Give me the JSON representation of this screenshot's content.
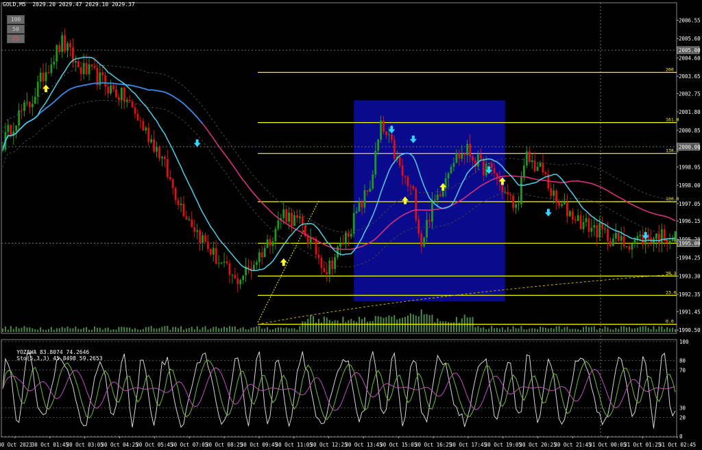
{
  "symbol_header": "GOLD,M5  2029.20 2029.47 2029.10 2029.37",
  "timeframe_buttons": [
    "100",
    "50",
    "25"
  ],
  "oscillator_header": {
    "indicator": "YOZAWA 83.8074 74.2646",
    "stochastic": "Sto(5,3,3) 45.8498 59.2653"
  },
  "colors": {
    "background": "#000000",
    "bull_candle": "#1f9a1f",
    "bear_candle": "#e01010",
    "fast_ma": "#4fd0e8",
    "slow_ma_blue": "#3a8ce8",
    "slow_ma_magenta": "#d6317a",
    "fibonacci": "#ffff00",
    "highlight_box": "#0a0a8c",
    "volume": "#4d8a4d",
    "arrow_up": "#ffff33",
    "arrow_down": "#33d6ff"
  },
  "chart_data": [
    {
      "type": "candlestick",
      "title": "GOLD,M5",
      "ylim": [
        1990.4,
        2007.1
      ],
      "price_axis_labels": [
        "2006.55",
        "2005.60",
        "2004.60",
        "2003.65",
        "2002.75",
        "2001.80",
        "2000.85",
        "1999.90",
        "1998.95",
        "1998.00",
        "1997.05",
        "1996.15",
        "1995.20",
        "1994.25",
        "1993.30",
        "1992.35",
        "1991.45",
        "1990.50"
      ],
      "price_axis_tags": [
        "2005.00",
        "2000.00",
        "1995.00"
      ],
      "time_labels": [
        "30 Oct 2023",
        "30 Oct 01:45",
        "30 Oct 03:05",
        "30 Oct 04:25",
        "30 Oct 05:45",
        "30 Oct 07:05",
        "30 Oct 08:25",
        "30 Oct 09:45",
        "30 Oct 11:05",
        "30 Oct 12:25",
        "30 Oct 13:45",
        "30 Oct 15:05",
        "30 Oct 16:25",
        "30 Oct 17:45",
        "30 Oct 19:05",
        "30 Oct 20:25",
        "30 Oct 21:45",
        "31 Oct 00:05",
        "31 Oct 01:25",
        "31 Oct 02:45"
      ],
      "price_path": [
        [
          0,
          2000.2
        ],
        [
          5,
          2001.5
        ],
        [
          10,
          2002.2
        ],
        [
          16,
          2004.0
        ],
        [
          22,
          2005.4
        ],
        [
          28,
          2004.1
        ],
        [
          34,
          2003.7
        ],
        [
          40,
          2003.0
        ],
        [
          46,
          2002.4
        ],
        [
          52,
          2001.0
        ],
        [
          58,
          1999.7
        ],
        [
          62,
          1998.2
        ],
        [
          66,
          1997.0
        ],
        [
          72,
          1995.6
        ],
        [
          78,
          1994.4
        ],
        [
          82,
          1993.7
        ],
        [
          86,
          1993.0
        ],
        [
          92,
          1993.8
        ],
        [
          98,
          1995.0
        ],
        [
          104,
          1996.6
        ],
        [
          110,
          1996.0
        ],
        [
          115,
          1994.8
        ],
        [
          120,
          1993.6
        ],
        [
          125,
          1994.8
        ],
        [
          130,
          1996.2
        ],
        [
          136,
          1998.0
        ],
        [
          140,
          2001.0
        ],
        [
          144,
          2000.0
        ],
        [
          148,
          1998.5
        ],
        [
          152,
          1997.5
        ],
        [
          155,
          1995.0
        ],
        [
          158,
          1996.5
        ],
        [
          162,
          1997.8
        ],
        [
          166,
          1999.3
        ],
        [
          172,
          1999.8
        ],
        [
          177,
          1999.0
        ],
        [
          182,
          1998.7
        ],
        [
          186,
          1997.6
        ],
        [
          190,
          1996.8
        ],
        [
          194,
          1999.4
        ],
        [
          200,
          1998.7
        ],
        [
          205,
          1997.0
        ],
        [
          210,
          1996.6
        ],
        [
          215,
          1996.0
        ],
        [
          220,
          1995.7
        ],
        [
          225,
          1995.3
        ],
        [
          230,
          1995.0
        ],
        [
          235,
          1995.2
        ],
        [
          240,
          1995.3
        ],
        [
          245,
          1995.4
        ],
        [
          249,
          1995.3
        ]
      ],
      "fibonacci_levels": [
        {
          "label": "200",
          "price": 2003.85
        },
        {
          "label": "161.8",
          "price": 2001.25
        },
        {
          "label": "138.2",
          "price": 1999.65
        },
        {
          "label": "100.0",
          "price": 1997.15
        },
        {
          "label": "61.8",
          "price": 1995.0
        },
        {
          "label": "38.2",
          "price": 1993.3
        },
        {
          "label": "23.6",
          "price": 1992.3
        },
        {
          "label": "0.0",
          "price": 1990.8
        }
      ],
      "signals": [
        {
          "type": "up",
          "time_index": 16,
          "price": 2003.0
        },
        {
          "type": "down",
          "time_index": 72,
          "price": 2000.2
        },
        {
          "type": "up",
          "time_index": 104,
          "price": 1994.0
        },
        {
          "type": "down",
          "time_index": 144,
          "price": 2000.9
        },
        {
          "type": "down",
          "time_index": 152,
          "price": 2000.4
        },
        {
          "type": "up",
          "time_index": 149,
          "price": 1997.2
        },
        {
          "type": "up",
          "time_index": 163,
          "price": 1997.9
        },
        {
          "type": "down",
          "time_index": 180,
          "price": 1998.8
        },
        {
          "type": "up",
          "time_index": 185,
          "price": 1998.2
        },
        {
          "type": "down",
          "time_index": 202,
          "price": 1996.6
        },
        {
          "type": "down",
          "time_index": 238,
          "price": 1995.4
        }
      ],
      "highlight_box": {
        "time_from": 130,
        "time_to": 186,
        "price_high": 2002.4,
        "price_low": 1992.0
      }
    },
    {
      "type": "line",
      "title": "YOZAWA / Stochastic",
      "ylim": [
        0,
        100
      ],
      "levels": [
        0,
        20,
        30,
        70,
        80,
        100
      ],
      "series": [
        {
          "name": "YOZAWA",
          "color": "#d8d8d8"
        },
        {
          "name": "Sto(5,3,3) %K",
          "color": "#70c030"
        },
        {
          "name": "Sto(5,3,3) %D",
          "color": "#c050c0"
        }
      ]
    }
  ]
}
